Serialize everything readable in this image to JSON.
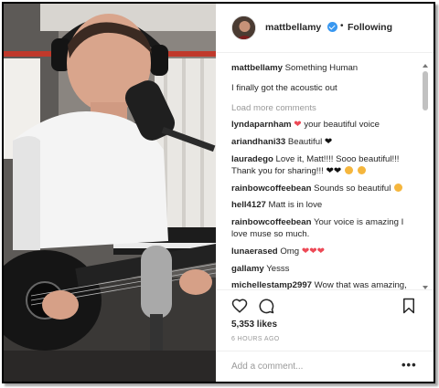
{
  "header": {
    "username": "mattbellamy",
    "separator": "•",
    "follow_status": "Following"
  },
  "caption": {
    "username": "mattbellamy",
    "text": "Something Human",
    "text2": "I finally got the acoustic out"
  },
  "load_more": "Load more comments",
  "comments": [
    {
      "user": "lyndaparnham",
      "text": "your beautiful voice"
    },
    {
      "user": "ariandhani33",
      "text": "Beautiful"
    },
    {
      "user": "lauradego",
      "text": "Love it, Matt!!!! Sooo beautiful!!! Thank you for sharing!!!"
    },
    {
      "user": "rainbowcoffeebean",
      "text": "Sounds so beautiful"
    },
    {
      "user": "hell4127",
      "text": "Matt is in love"
    },
    {
      "user": "rainbowcoffeebean",
      "text": "Your voice is amazing I love muse so much."
    },
    {
      "user": "lunaerased",
      "text": "Omg"
    },
    {
      "user": "gallamy",
      "text": "Yesss"
    },
    {
      "user": "michellestamp2997",
      "text": "Wow that was amazing, thank you. Been singing Muse all"
    }
  ],
  "likes": "5,353 likes",
  "timestamp": "6 HOURS AGO",
  "add_comment": {
    "placeholder": "Add a comment..."
  },
  "more_label": "•••",
  "icons": {
    "like": "heart-outline-icon",
    "comment": "speech-bubble-icon",
    "save": "bookmark-icon",
    "verified": "verified-badge-icon",
    "more": "more-options-icon"
  },
  "colors": {
    "verified": "#3897f0",
    "heart": "#ed4956",
    "muted": "#999999",
    "text": "#262626"
  }
}
